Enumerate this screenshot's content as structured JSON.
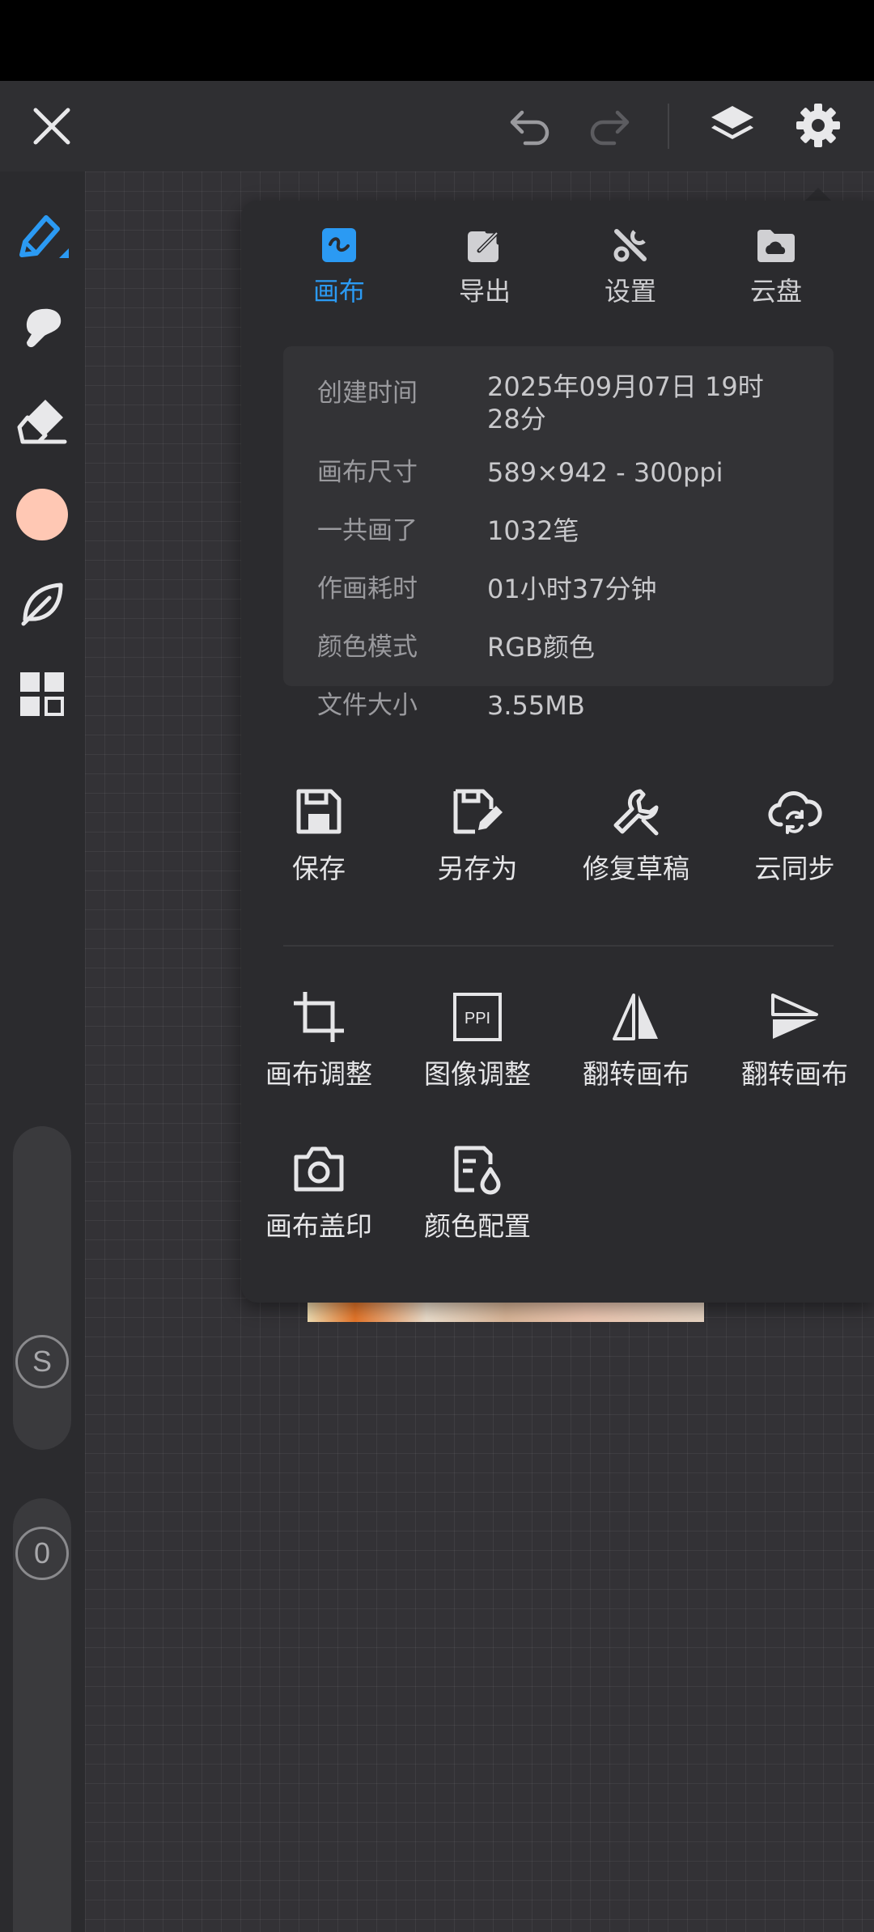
{
  "colors": {
    "accent": "#2b9af3",
    "brush_color": "#ffc8b4",
    "panel_bg": "#2b2b2e",
    "canvas_bg": "#333236"
  },
  "topbar": {
    "icons": [
      "close-icon",
      "undo-icon",
      "redo-icon",
      "layers-icon",
      "settings-gear-icon"
    ]
  },
  "sidebar": {
    "tools": [
      "pen-tool-icon",
      "smudge-tool-icon",
      "eraser-tool-icon",
      "color-swatch",
      "leaf-brush-icon",
      "grid-menu-icon"
    ],
    "size_slider_label": "S",
    "opacity_slider_label": "0"
  },
  "panel": {
    "tabs": [
      {
        "label": "画布",
        "icon": "canvas-tab-icon",
        "active": true
      },
      {
        "label": "导出",
        "icon": "export-tab-icon",
        "active": false
      },
      {
        "label": "设置",
        "icon": "settings-tab-icon",
        "active": false
      },
      {
        "label": "云盘",
        "icon": "cloud-drive-tab-icon",
        "active": false
      }
    ],
    "info": [
      {
        "key": "创建时间",
        "value": "2025年09月07日 19时"
      },
      {
        "key": "画布尺寸",
        "value": "589×942 - 300ppi"
      },
      {
        "key": "一共画了",
        "value": "1032笔"
      },
      {
        "key": "作画耗时",
        "value": "01小时37分钟"
      },
      {
        "key": "颜色模式",
        "value": "RGB颜色"
      },
      {
        "key": "文件大小",
        "value": "3.55MB"
      }
    ],
    "info_value_overflow": "28分",
    "actions_row1": [
      {
        "label": "保存",
        "icon": "save-icon"
      },
      {
        "label": "另存为",
        "icon": "save-as-icon"
      },
      {
        "label": "修复草稿",
        "icon": "repair-draft-icon"
      },
      {
        "label": "云同步",
        "icon": "cloud-sync-icon"
      }
    ],
    "actions_row2": [
      {
        "label": "画布调整",
        "icon": "crop-icon"
      },
      {
        "label": "图像调整",
        "icon": "ppi-icon"
      },
      {
        "label": "翻转画布",
        "icon": "flip-horizontal-icon"
      },
      {
        "label": "翻转画布",
        "icon": "flip-vertical-icon"
      }
    ],
    "actions_row3": [
      {
        "label": "画布盖印",
        "icon": "camera-stamp-icon"
      },
      {
        "label": "颜色配置",
        "icon": "color-profile-icon"
      }
    ]
  }
}
